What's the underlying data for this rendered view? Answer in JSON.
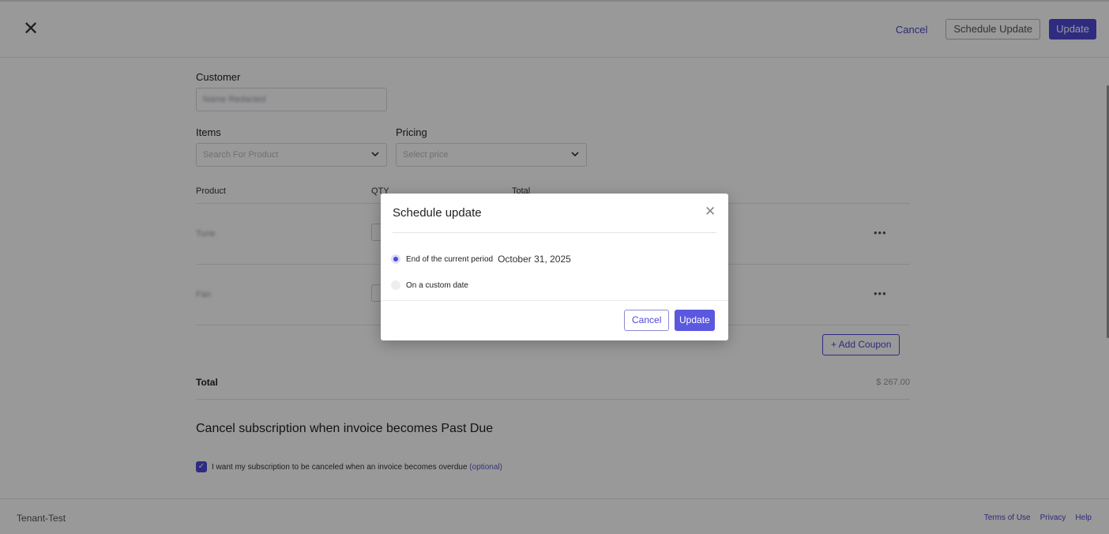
{
  "header": {
    "cancel_label": "Cancel",
    "schedule_label": "Schedule Update",
    "update_label": "Update"
  },
  "form": {
    "customer_label": "Customer",
    "customer_value": "Name Redacted",
    "items_label": "Items",
    "items_placeholder": "Search For Product",
    "pricing_label": "Pricing",
    "pricing_placeholder": "Select price"
  },
  "table": {
    "headers": [
      "Product",
      "QTY",
      "Total"
    ],
    "rows": [
      {
        "product": "Tune"
      },
      {
        "product": "Fan"
      }
    ],
    "row_menu": "•••"
  },
  "coupon_label": "+ Add Coupon",
  "total": {
    "label": "Total",
    "value": "$ 267.00"
  },
  "cancel_section": {
    "title": "Cancel subscription when invoice becomes Past Due",
    "checkbox_label": "I want my subscription to be canceled when an invoice becomes overdue",
    "optional": "(optional)",
    "checked": true
  },
  "footer": {
    "tenant": "Tenant-Test",
    "links": [
      "Terms of Use",
      "Privacy",
      "Help"
    ]
  },
  "modal": {
    "title": "Schedule update",
    "option_1": "End of the current period",
    "option_1_date": "October 31, 2025",
    "option_2": "On a custom date",
    "selected": "option_1",
    "cancel_label": "Cancel",
    "update_label": "Update"
  },
  "colors": {
    "accent": "#4e49d6",
    "overlay": "rgba(0,0,0,0.4)"
  }
}
